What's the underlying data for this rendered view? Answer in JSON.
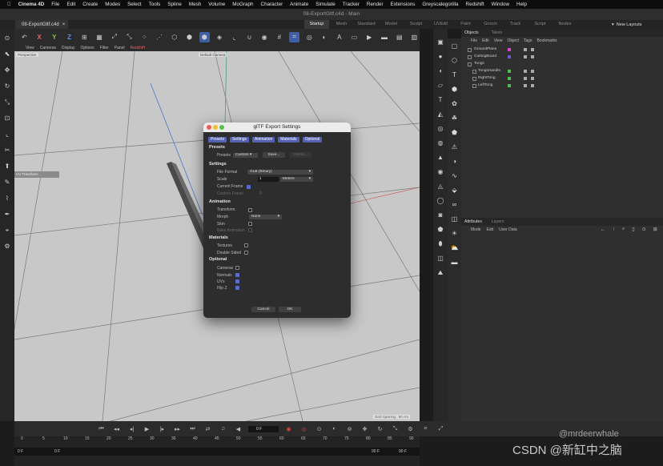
{
  "menubar": {
    "items": [
      "Cinema 4D",
      "File",
      "Edit",
      "Create",
      "Modes",
      "Select",
      "Tools",
      "Spline",
      "Mesh",
      "Volume",
      "MoGraph",
      "Character",
      "Animate",
      "Simulate",
      "Tracker",
      "Render",
      "Extensions",
      "Greyscalegorilla",
      "Redshift",
      "Window",
      "Help"
    ]
  },
  "window": {
    "title": "08-ExportGltf.c4d - Main"
  },
  "file_tab": {
    "label": "08-ExportGltf.c4d"
  },
  "layout_tabs": [
    "Startup",
    "Mesh",
    "Standard",
    "Model",
    "Sculpt",
    "UVEdit",
    "Paint",
    "Groom",
    "Track",
    "Script",
    "Nodes"
  ],
  "new_layouts": "New Layouts",
  "toolbar": {
    "x": "X",
    "y": "Y",
    "z": "Z"
  },
  "viewport": {
    "menu": [
      "View",
      "Cameras",
      "Display",
      "Options",
      "Filter",
      "Panel",
      "Redshift"
    ],
    "label": "Perspective",
    "camera": "Default Camera",
    "uv_tag": "UV Transform",
    "grid": "Grid Spacing : 50 cm"
  },
  "dialog": {
    "title": "glTF Export Settings",
    "tabs": [
      "Presets",
      "Settings",
      "Animation",
      "Materials",
      "Optional"
    ],
    "presets": {
      "section": "Presets",
      "label": "Presets",
      "value": "Custom",
      "save": "Save...",
      "delete": "Delete..."
    },
    "settings": {
      "section": "Settings",
      "file_format_label": "File Format",
      "file_format": "GLB (Binary)",
      "scale_label": "Scale",
      "scale_value": "1",
      "scale_unit": "Meters",
      "current_frame_label": "Current Frame",
      "current_frame": true,
      "custom_frame_label": "Custom Frame",
      "custom_frame_value": "0"
    },
    "animation": {
      "section": "Animation",
      "transform_label": "Transform",
      "transform": false,
      "morph_label": "Morph",
      "morph_value": "None",
      "skin_label": "Skin",
      "skin": false,
      "bake_label": "Bake Animation",
      "bake": false
    },
    "materials": {
      "section": "Materials",
      "textures_label": "Textures",
      "textures": false,
      "double_sided_label": "Double Sided",
      "double_sided": false
    },
    "optional": {
      "section": "Optional",
      "cameras_label": "Cameras",
      "cameras": false,
      "normals_label": "Normals",
      "normals": true,
      "uvs_label": "UVs",
      "uvs": true,
      "flipz_label": "Flip Z",
      "flipz": true
    },
    "cancel": "Cancel",
    "ok": "OK"
  },
  "objects_panel": {
    "tabs": [
      "Objects",
      "Takes"
    ],
    "menu": [
      "File",
      "Edit",
      "View",
      "Object",
      "Tags",
      "Bookmarks"
    ],
    "items": [
      {
        "name": "GroundPlane",
        "swatch": "#d946c8"
      },
      {
        "name": "CuttingBoard",
        "swatch": "#6a5ad0"
      },
      {
        "name": "Tongs",
        "swatch": ""
      },
      {
        "name": "TongsHandle",
        "swatch": "#4cbf4c"
      },
      {
        "name": "RightTong",
        "swatch": "#4cbf4c"
      },
      {
        "name": "LeftTong",
        "swatch": "#4cbf4c"
      }
    ]
  },
  "attributes_panel": {
    "tabs": [
      "Attributes",
      "Layers"
    ],
    "menu": [
      "Mode",
      "Edit",
      "User Data"
    ]
  },
  "timeline": {
    "frame": "0 F",
    "ruler": [
      "0",
      "5",
      "10",
      "15",
      "20",
      "25",
      "30",
      "35",
      "40",
      "45",
      "50",
      "55",
      "60",
      "65",
      "70",
      "75",
      "80",
      "85",
      "90"
    ],
    "range_start": "0 F",
    "range_start2": "0 F",
    "range_end": "90 F",
    "range_end2": "90 F"
  },
  "watermark": "CSDN @新缸中之脑",
  "watermark_id": "@mrdeerwhale"
}
